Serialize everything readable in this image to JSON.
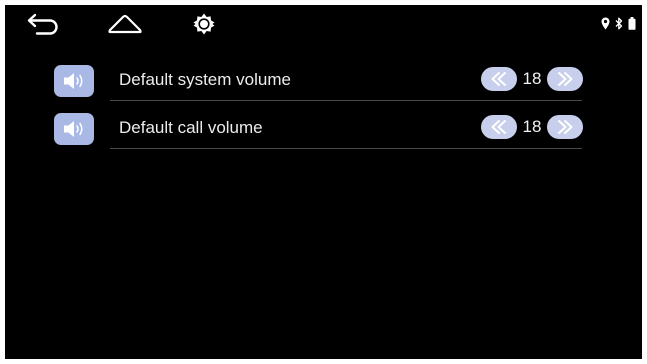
{
  "status_bar": {
    "nav_icons": [
      "back-arrow-icon",
      "home-icon",
      "brightness-icon"
    ],
    "status_icons": [
      "location-pin-icon",
      "bluetooth-icon",
      "battery-icon"
    ]
  },
  "settings": [
    {
      "icon": "speaker-icon",
      "label": "Default system volume",
      "value": "18"
    },
    {
      "icon": "speaker-icon",
      "label": "Default call volume",
      "value": "18"
    }
  ],
  "colors": {
    "background": "#000000",
    "icon_tile": "#aab8e6",
    "stepper_button": "#c7cfec",
    "text": "#ececec",
    "divider": "#4a4a4a"
  }
}
